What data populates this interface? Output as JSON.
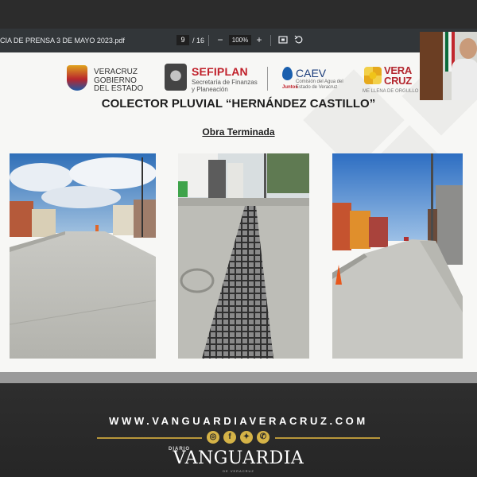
{
  "pdf_viewer": {
    "file_name": "CIA DE PRENSA 3 DE MAYO 2023.pdf",
    "current_page": "9",
    "total_pages": "/ 16",
    "zoom_out": "−",
    "zoom_level": "100%",
    "zoom_in": "+",
    "fit_icon": "fit-page-icon",
    "rotate_icon": "rotate-icon"
  },
  "slide": {
    "logos": {
      "gobierno": {
        "l1": "VERACRUZ",
        "l2": "GOBIERNO",
        "l3": "DEL ESTADO"
      },
      "sefiplan": {
        "name": "SEFIPLAN",
        "s1": "Secretaría de Finanzas",
        "s2": "y Planeación"
      },
      "caev": {
        "name": "CAEV",
        "s1": "Comisión del Agua del",
        "s2": "Estado de Veracruz",
        "jul": "Juntos"
      },
      "veracruz": {
        "v1": "VERA",
        "v2": "CRUZ",
        "tag": "ME LLENA DE ORGULLO"
      }
    },
    "title": "COLECTOR PLUVIAL “HERNÁNDEZ CASTILLO”",
    "subtitle": "Obra Terminada"
  },
  "footer": {
    "url": "WWW.VANGUARDIAVERACRUZ.COM",
    "brand_prefix": "DIARIO",
    "brand": "VANGUARDIA",
    "brand_suffix": "DE VERACRUZ",
    "social": [
      "instagram-icon",
      "facebook-icon",
      "twitter-icon",
      "whatsapp-icon"
    ]
  },
  "colors": {
    "accent_gold": "#d5b347",
    "sefiplan_red": "#c0202a",
    "caev_blue": "#1a5fae"
  }
}
